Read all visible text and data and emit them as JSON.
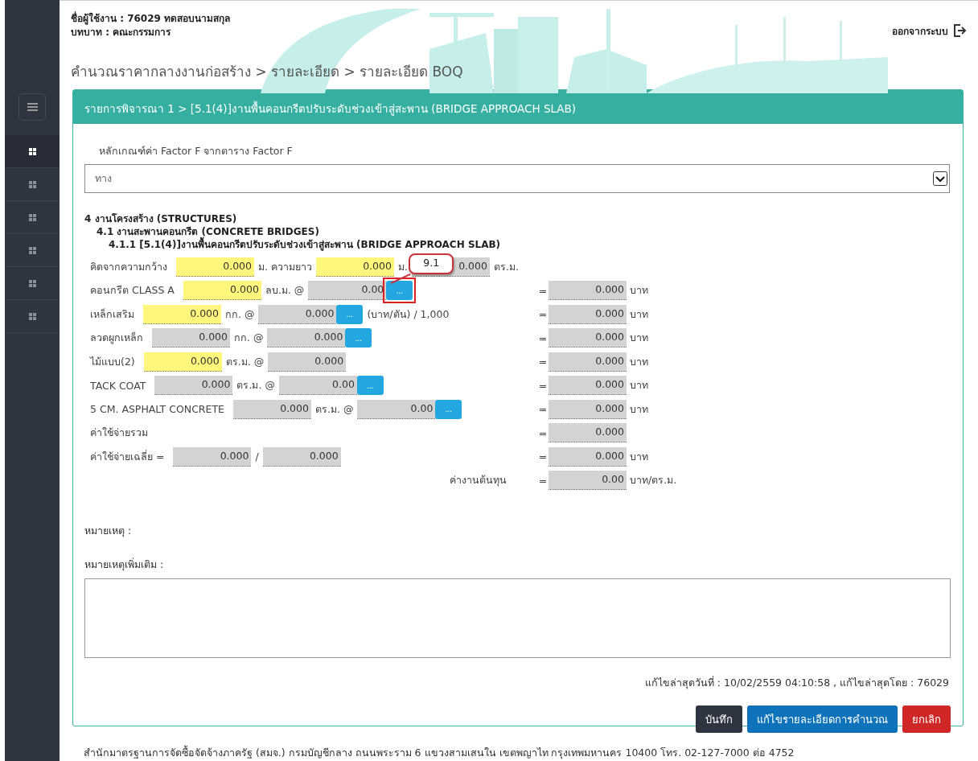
{
  "user": {
    "name_line": "ชื่อผู้ใช้งาน : 76029 ทดสอบนามสกุล",
    "role_line": "บทบาท : คณะกรรมการ"
  },
  "logout": "ออกจากระบบ",
  "breadcrumb": "คำนวณราคากลางงานก่อสร้าง > รายละเอียด > รายละเอียด BOQ",
  "sidebar": {
    "items": [
      {
        "selected": true
      },
      {
        "selected": false
      },
      {
        "selected": false
      },
      {
        "selected": false
      },
      {
        "selected": false
      },
      {
        "selected": false
      }
    ]
  },
  "panel_title": "รายการพิจารณา 1 > [5.1(4)]งานพื้นคอนกรีตปรับระดับช่วงเข้าสู่สะพาน (BRIDGE APPROACH SLAB)",
  "factor": {
    "label": "หลักเกณฑ์ค่า Factor F จากตาราง Factor F",
    "value": "ทาง"
  },
  "sections": [
    {
      "text": "4 งานโครงสร้าง (STRUCTURES)",
      "children": [
        {
          "text": "4.1 งานสะพานคอนกรีต (CONCRETE BRIDGES)",
          "children": [
            {
              "text": "4.1.1 [5.1(4)]งานพื้นคอนกรีตปรับระดับช่วงเข้าสู่สะพาน (BRIDGE APPROACH SLAB)"
            }
          ]
        }
      ]
    }
  ],
  "rows": [
    {
      "kind": "item",
      "left": [
        {
          "kind": "label",
          "text": "คิดจากความกว้าง"
        },
        {
          "kind": "field",
          "value": "0.000",
          "editable": true
        },
        {
          "kind": "unit",
          "text": "ม. ความยาว"
        },
        {
          "kind": "field",
          "value": "0.000",
          "editable": true
        },
        {
          "kind": "unit",
          "text": "ม."
        },
        {
          "kind": "field",
          "value": "0.000",
          "editable": false
        },
        {
          "kind": "unit",
          "text": "ตร.ม."
        }
      ]
    },
    {
      "kind": "item",
      "left": [
        {
          "kind": "label",
          "text": "คอนกรีต CLASS A"
        },
        {
          "kind": "field",
          "value": "0.000",
          "editable": true
        },
        {
          "kind": "unit",
          "text": "ลบ.ม. @"
        },
        {
          "kind": "field",
          "value": "0.00",
          "editable": false
        },
        {
          "kind": "button",
          "text": "...",
          "highlighted": true,
          "callout": "9.1"
        }
      ],
      "total": {
        "sign": "=",
        "value": "0.000",
        "unit": "บาท"
      }
    },
    {
      "kind": "item",
      "left": [
        {
          "kind": "label",
          "text": "เหล็กเสริม"
        },
        {
          "kind": "field",
          "value": "0.000",
          "editable": true
        },
        {
          "kind": "unit",
          "text": "กก. @"
        },
        {
          "kind": "field",
          "value": "0.000",
          "editable": false
        },
        {
          "kind": "button",
          "text": "...",
          "highlighted": false
        },
        {
          "kind": "unit",
          "text": "(บาท/ตัน) / 1,000"
        }
      ],
      "total": {
        "sign": "=",
        "value": "0.000",
        "unit": "บาท"
      }
    },
    {
      "kind": "item",
      "left": [
        {
          "kind": "label",
          "text": "ลวดผูกเหล็ก"
        },
        {
          "kind": "field",
          "value": "0.000",
          "editable": false
        },
        {
          "kind": "unit",
          "text": "กก. @"
        },
        {
          "kind": "field",
          "value": "0.000",
          "editable": false
        },
        {
          "kind": "button",
          "text": "...",
          "highlighted": false
        }
      ],
      "total": {
        "sign": "=",
        "value": "0.000",
        "unit": "บาท"
      }
    },
    {
      "kind": "item",
      "left": [
        {
          "kind": "label",
          "text": "ไม้แบบ(2)"
        },
        {
          "kind": "field",
          "value": "0.000",
          "editable": true
        },
        {
          "kind": "unit",
          "text": "ตร.ม. @"
        },
        {
          "kind": "field",
          "value": "0.000",
          "editable": false
        }
      ],
      "total": {
        "sign": "=",
        "value": "0.000",
        "unit": "บาท"
      }
    },
    {
      "kind": "item",
      "left": [
        {
          "kind": "label",
          "text": "TACK COAT"
        },
        {
          "kind": "field",
          "value": "0.000",
          "editable": false
        },
        {
          "kind": "unit",
          "text": "ตร.ม. @"
        },
        {
          "kind": "field",
          "value": "0.00",
          "editable": false
        },
        {
          "kind": "button",
          "text": "...",
          "highlighted": false
        }
      ],
      "total": {
        "sign": "=",
        "value": "0.000",
        "unit": "บาท"
      }
    },
    {
      "kind": "item",
      "left": [
        {
          "kind": "label",
          "text": "5 CM. ASPHALT CONCRETE"
        },
        {
          "kind": "field",
          "value": "0.000",
          "editable": false
        },
        {
          "kind": "unit",
          "text": "ตร.ม. @"
        },
        {
          "kind": "field",
          "value": "0.00",
          "editable": false
        },
        {
          "kind": "button",
          "text": "...",
          "highlighted": false
        }
      ],
      "total": {
        "sign": "=",
        "value": "0.000",
        "unit": "บาท"
      }
    },
    {
      "kind": "item",
      "left": [
        {
          "kind": "label",
          "text": "ค่าใช้จ่ายรวม"
        }
      ],
      "total": {
        "sign": "=",
        "value": "0.000"
      }
    },
    {
      "kind": "item",
      "left": [
        {
          "kind": "label",
          "text": "ค่าใช้จ่ายเฉลี่ย ="
        },
        {
          "kind": "field",
          "value": "0.000",
          "editable": false
        },
        {
          "kind": "unit",
          "text": "/"
        },
        {
          "kind": "field",
          "value": "0.000",
          "editable": false
        }
      ],
      "total": {
        "sign": "=",
        "value": "0.000",
        "unit": "บาท"
      }
    },
    {
      "kind": "summary",
      "left": [
        {
          "kind": "label",
          "text": "ค่างานต้นทุน"
        }
      ],
      "total": {
        "sign": "=",
        "value": "0.00",
        "unit": "บาท/ตร.ม."
      }
    }
  ],
  "remarks_label": "หมายเหตุ :",
  "extra_remarks": {
    "label": "หมายเหตุเพิ่มเติม :"
  },
  "edit_info": "แก้ไขล่าสุดวันที่ : 10/02/2559 04:10:58 , แก้ไขล่าสุดโดย : 76029",
  "buttons": [
    {
      "kind": "save",
      "label": "บันทึก"
    },
    {
      "kind": "edit",
      "label": "แก้ไขรายละเอียดการคำนวณ"
    },
    {
      "kind": "cancel",
      "label": "ยกเลิก"
    }
  ],
  "footer": "สำนักมาตรฐานการจัดซื้อจัดจ้างภาครัฐ (สมจ.) กรมบัญชีกลาง ถนนพระราม 6 แขวงสามเสนใน เขตพญาไท กรุงเทพมหานคร 10400 โทร. 02-127-7000 ต่อ 4752"
}
